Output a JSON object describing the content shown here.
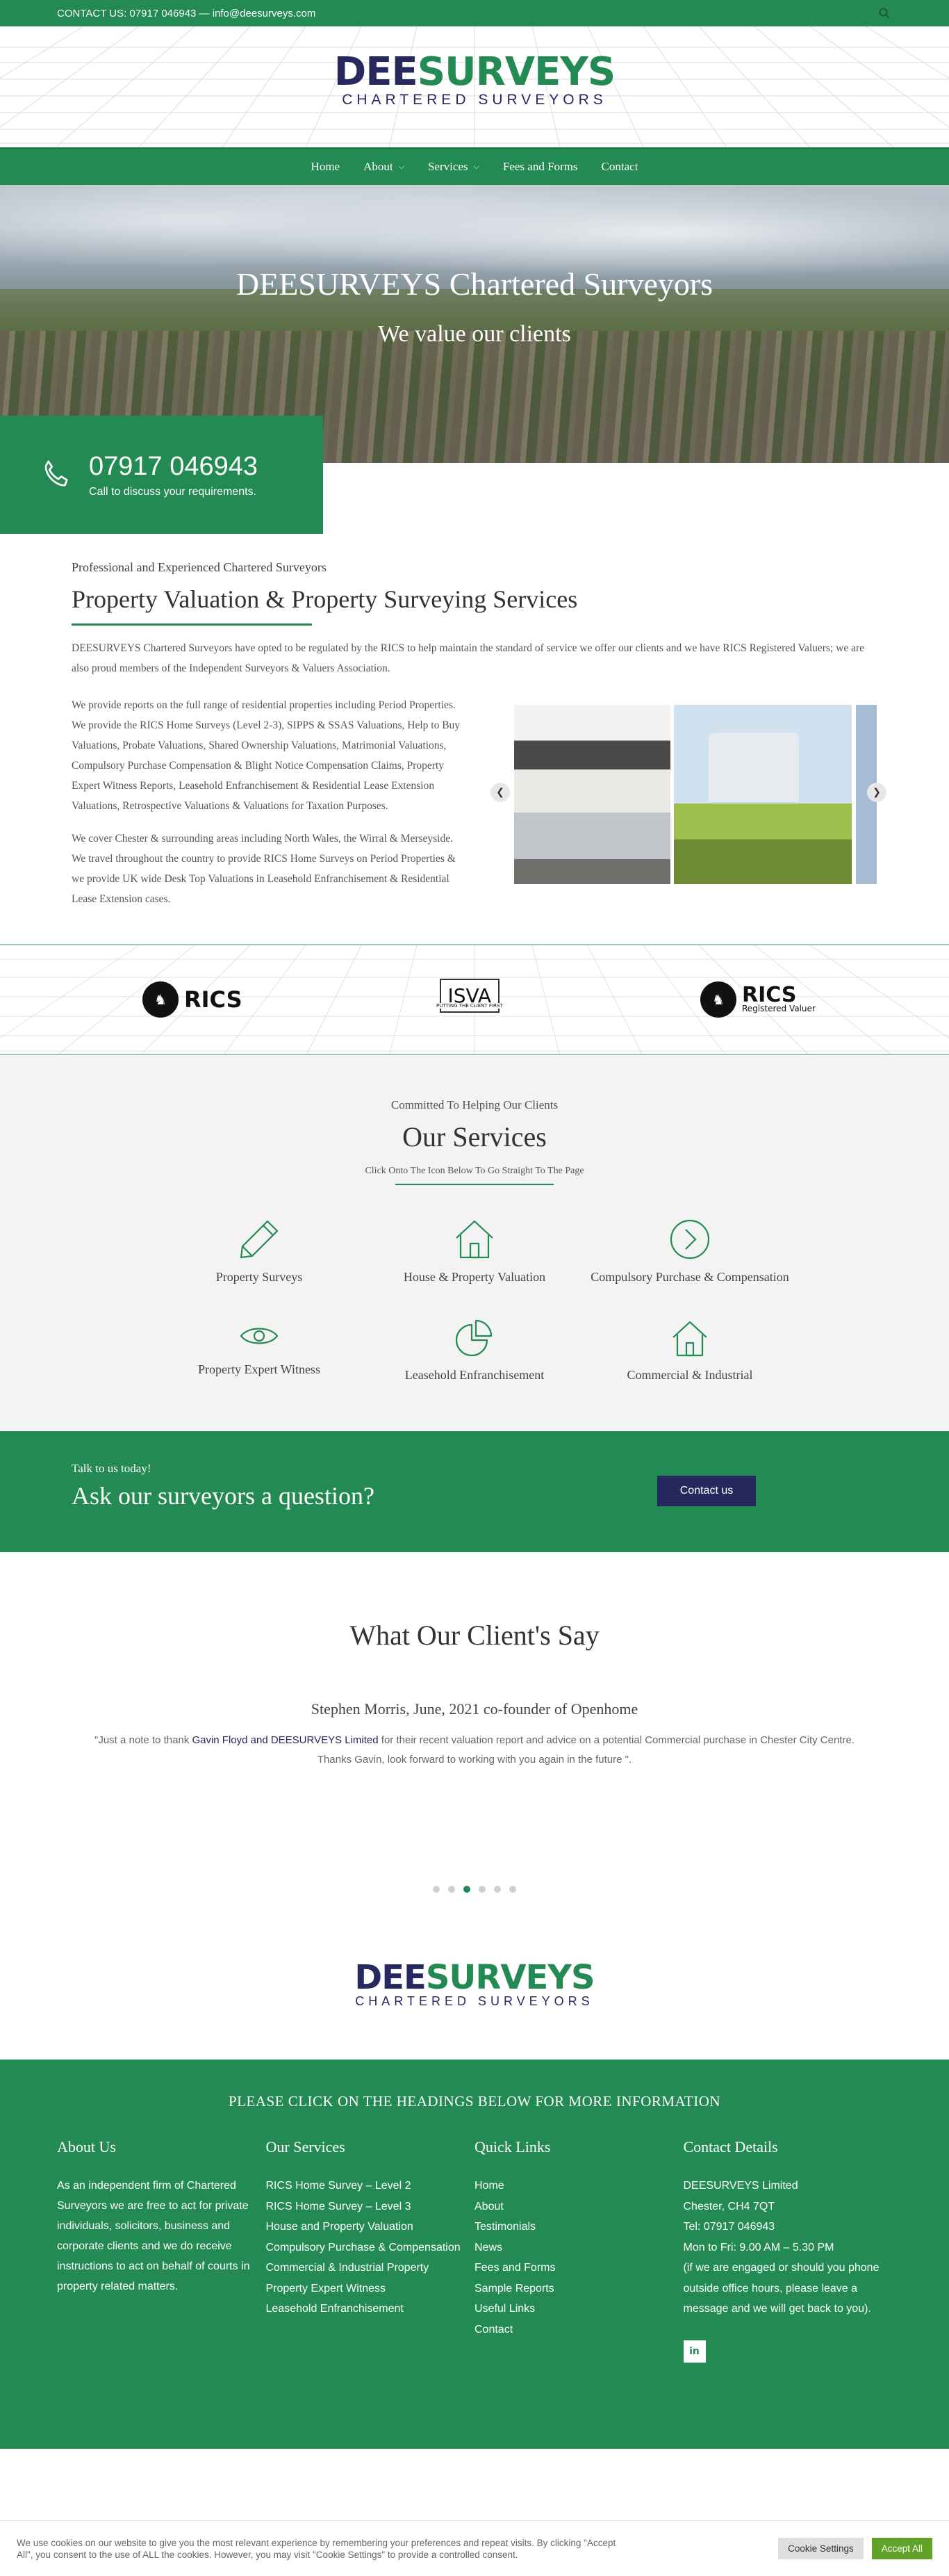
{
  "topbar": {
    "contact": "CONTACT US: 07917 046943 — info@deesurveys.com",
    "search_icon": "search-icon"
  },
  "brand": {
    "name_part1": "DEE",
    "name_part2": "SURVEYS",
    "tagline": "CHARTERED SURVEYORS",
    "colors": {
      "green": "#228a52",
      "navy": "#26285e"
    }
  },
  "nav": {
    "items": [
      {
        "label": "Home",
        "dropdown": false
      },
      {
        "label": "About",
        "dropdown": true
      },
      {
        "label": "Services",
        "dropdown": true
      },
      {
        "label": "Fees and Forms",
        "dropdown": false
      },
      {
        "label": "Contact",
        "dropdown": false
      }
    ]
  },
  "hero": {
    "title": "DEESURVEYS Chartered Surveyors",
    "subtitle": "We value our clients"
  },
  "phone_box": {
    "number": "07917 046943",
    "caption": "Call to discuss your requirements."
  },
  "intro": {
    "kicker": "Professional and Experienced Chartered Surveyors",
    "heading": "Property Valuation & Property Surveying Services",
    "para1": "DEESURVEYS Chartered Surveyors have opted to be regulated by the RICS to help maintain the standard of service we offer our clients and we have RICS Registered Valuers; we are also proud members of the Independent Surveyors & Valuers Association.",
    "para2": "We provide reports on the full range of residential properties including Period Properties. We provide the RICS Home Surveys (Level 2-3), SIPPS & SSAS Valuations, Help to Buy Valuations, Probate Valuations, Shared Ownership Valuations, Matrimonial Valuations, Compulsory Purchase Compensation & Blight Notice Compensation Claims, Property Expert Witness Reports, Leasehold Enfranchisement & Residential Lease Extension Valuations, Retrospective Valuations & Valuations for Taxation Purposes.",
    "para3": "We cover Chester & surrounding areas including North Wales, the Wirral & Merseyside. We travel throughout the country to provide RICS Home Surveys on Period Properties & we provide UK wide Desk Top Valuations in Leasehold Enfranchisement & Residential Lease Extension cases."
  },
  "accreditations": {
    "rics": "RICS",
    "isva": "ISVA",
    "isva_sub": "PUTTING THE CLIENT FIRST",
    "rics_valuer": "RICS",
    "rics_valuer_sub": "Registered Valuer"
  },
  "services": {
    "kicker": "Committed To Helping Our Clients",
    "heading": "Our Services",
    "hint": "Click Onto The Icon Below To Go Straight To The Page",
    "items": [
      {
        "label": "Property Surveys",
        "icon": "pencil-icon"
      },
      {
        "label": "House & Property Valuation",
        "icon": "house-icon"
      },
      {
        "label": "Compulsory Purchase & Compensation",
        "icon": "circle-arrow-icon"
      },
      {
        "label": "Property Expert Witness",
        "icon": "eye-icon"
      },
      {
        "label": "Leasehold Enfranchisement",
        "icon": "pie-chart-icon"
      },
      {
        "label": "Commercial & Industrial",
        "icon": "house-icon"
      }
    ]
  },
  "cta": {
    "small": "Talk to us today!",
    "big": "Ask our surveyors a question?",
    "button": "Contact us"
  },
  "testimonials": {
    "heading": "What Our Client's Say",
    "author": "Stephen Morris, June, 2021 co-founder of Openhome",
    "quote_pre": "\"Just a note to thank ",
    "quote_hl": "Gavin Floyd and DEESURVEYS Limited",
    "quote_post": " for their recent valuation report and advice on a potential Commercial purchase in Chester City Centre. Thanks Gavin, look forward to working with you again in the future \".",
    "active_dot": 3
  },
  "footer": {
    "heading": "PLEASE CLICK ON THE HEADINGS BELOW FOR MORE INFORMATION",
    "about": {
      "title": "About Us",
      "body": "As an independent firm of Chartered Surveyors we are free to act for private individuals, solicitors, business and corporate clients and we do receive instructions to act on behalf of courts in property related matters."
    },
    "services": {
      "title": "Our Services",
      "items": [
        "RICS Home Survey – Level 2",
        "RICS Home Survey – Level 3",
        "House and Property Valuation",
        "Compulsory Purchase & Compensation",
        "Commercial & Industrial Property",
        "Property Expert Witness",
        "Leasehold Enfranchisement"
      ]
    },
    "quick": {
      "title": "Quick Links",
      "items": [
        "Home",
        "About",
        "Testimonials",
        "News",
        "Fees and Forms",
        "Sample Reports",
        "Useful Links",
        "Contact"
      ]
    },
    "contact": {
      "title": "Contact Details",
      "items": [
        "DEESURVEYS Limited",
        "Chester, CH4 7QT",
        "Tel: 07917 046943",
        "Mon to Fri: 9.00 AM – 5.30 PM",
        "(if we are engaged or should you phone outside office hours, please leave a message and we will get back to you)."
      ],
      "linkedin": "in"
    }
  },
  "cookie": {
    "text": "We use cookies on our website to give you the most relevant experience by remembering your preferences and repeat visits. By clicking \"Accept All\", you consent to the use of ALL the cookies. However, you may visit \"Cookie Settings\" to provide a controlled consent.",
    "settings": "Cookie Settings",
    "accept": "Accept All"
  }
}
